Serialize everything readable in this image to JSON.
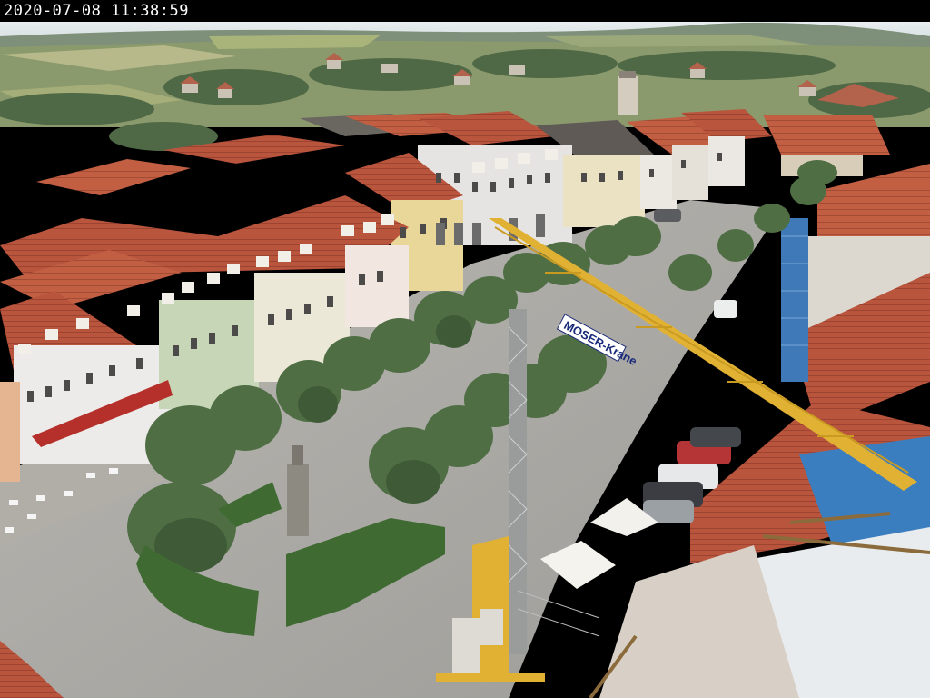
{
  "camera": {
    "timestamp": "2020-07-08  11:38:59"
  },
  "scene": {
    "crane_brand": "MOSER-Krane",
    "colors": {
      "sky": "#dfe6ea",
      "roof_tile": "#b5533c",
      "tree": "#4f6e44",
      "paving": "#a8a8a6",
      "crane": "#e0b133",
      "tarp": "#3a7ec0"
    }
  }
}
